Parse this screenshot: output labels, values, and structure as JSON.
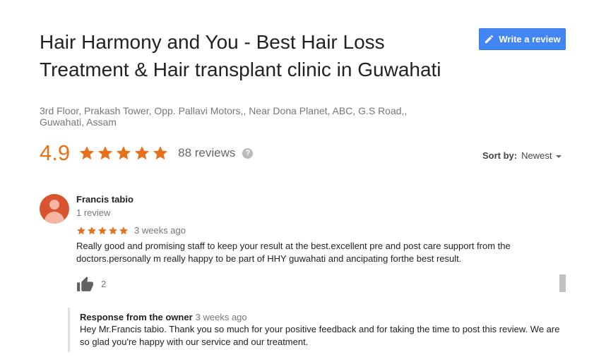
{
  "business": {
    "title": "Hair Harmony and You - Best Hair Loss Treatment & Hair transplant clinic in Guwahati",
    "address": "3rd Floor, Prakash Tower, Opp. Pallavi Motors,, Near Dona Planet, ABC, G.S Road,, Guwahati, Assam",
    "rating": "4.9",
    "stars": 5,
    "reviews_count": "88 reviews",
    "help_icon": "?"
  },
  "write_review": {
    "label": "Write a review",
    "icon": "pencil-icon"
  },
  "sort": {
    "label": "Sort by:",
    "value": "Newest"
  },
  "review": {
    "author": "Francis tabio",
    "author_meta": "1 review",
    "stars": 5,
    "time": "3 weeks ago",
    "text": "Really good and promising staff to keep your result  at the best.excellent pre and post care support from the doctors.personally m really happy to be part of HHY guwahati and ancipating forthe best result.",
    "likes": "2"
  },
  "owner_response": {
    "title": "Response from the owner",
    "time": "3 weeks ago",
    "text": "Hey Mr.Francis tabio. Thank you so much for your positive feedback and for taking the time to post this review. We are so glad you're happy with our service and our treatment."
  },
  "colors": {
    "star": "#e7711b",
    "button": "#4285f4"
  }
}
